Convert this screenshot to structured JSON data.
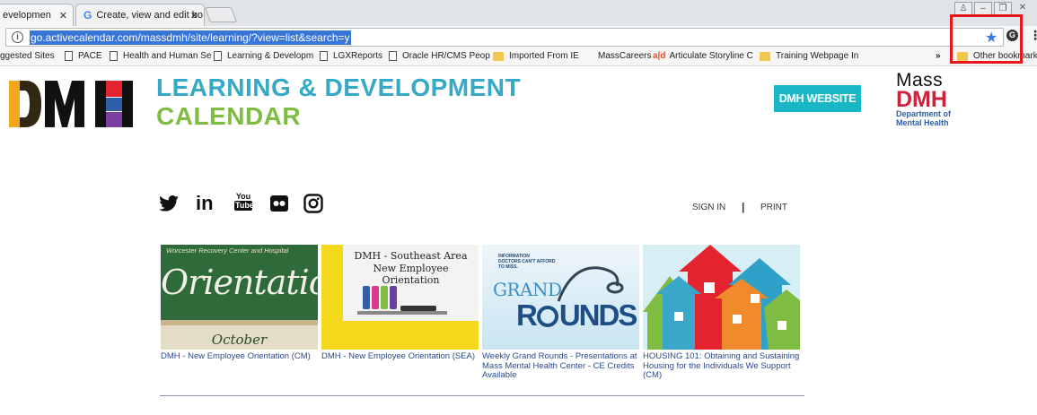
{
  "browser": {
    "tabs": [
      {
        "label": "evelopmen",
        "active": true
      },
      {
        "label": "Create, view and edit bo",
        "active": false
      }
    ],
    "url": "go.activecalendar.com/massdmh/site/learning/?view=list&search=y",
    "bookmarks": [
      {
        "label": "ggested Sites",
        "icon": "none"
      },
      {
        "label": "PACE",
        "icon": "page"
      },
      {
        "label": "Health and Human Se",
        "icon": "page"
      },
      {
        "label": "Learning & Developm",
        "icon": "page"
      },
      {
        "label": "LGXReports",
        "icon": "page"
      },
      {
        "label": "Oracle HR/CMS Peop",
        "icon": "page"
      },
      {
        "label": "Imported From IE",
        "icon": "folder"
      },
      {
        "label": "MassCareers",
        "icon": "none"
      },
      {
        "label": "Articulate Storyline C",
        "icon": "articulate"
      },
      {
        "label": "Training Webpage In",
        "icon": "folder"
      },
      {
        "label": "Other bookmarks",
        "icon": "folder"
      }
    ],
    "overflow": "»",
    "highlight_color": "#e8171b"
  },
  "header": {
    "logo_letters": "DM H",
    "title_line1": "LEARNING & DEVELOPMENT",
    "title_line2": "CALENDAR",
    "website_button": "DMH WEBSITE",
    "mass_logo": {
      "mass": "Mass",
      "dmh": "DMH",
      "dept_line1": "Department of",
      "dept_line2": "Mental Health"
    }
  },
  "social": {
    "icons": [
      "twitter-icon",
      "linkedin-icon",
      "youtube-icon",
      "flickr-icon",
      "instagram-icon"
    ],
    "linkedin_text": "in",
    "youtube_top": "You",
    "youtube_bottom": "Tube",
    "sign_in": "SIGN IN",
    "separator": "|",
    "print": "PRINT"
  },
  "events": [
    {
      "caption": "DMH - New Employee Orientation (CM)",
      "thumb_top": "Worcester Recovery Center and Hospital",
      "thumb_main": "Orientation",
      "thumb_bottom": "October"
    },
    {
      "caption": "DMH - New Employee Orientation (SEA)",
      "thumb_line1": "DMH - Southeast Area",
      "thumb_line2": "New Employee Orientation"
    },
    {
      "caption": "Weekly Grand Rounds - Presentations at Mass Mental Health Center - CE Credits Available",
      "thumb_small1": "INFORMATION",
      "thumb_small2": "DOCTORS CAN'T AFFORD",
      "thumb_small3": "TO MISS.",
      "thumb_word1": "GRAND",
      "thumb_word2": "R",
      "thumb_word3": "UNDS"
    },
    {
      "caption": "HOUSING 101: Obtaining and Sustaining Housing for the Individuals We Support (CM)"
    }
  ]
}
